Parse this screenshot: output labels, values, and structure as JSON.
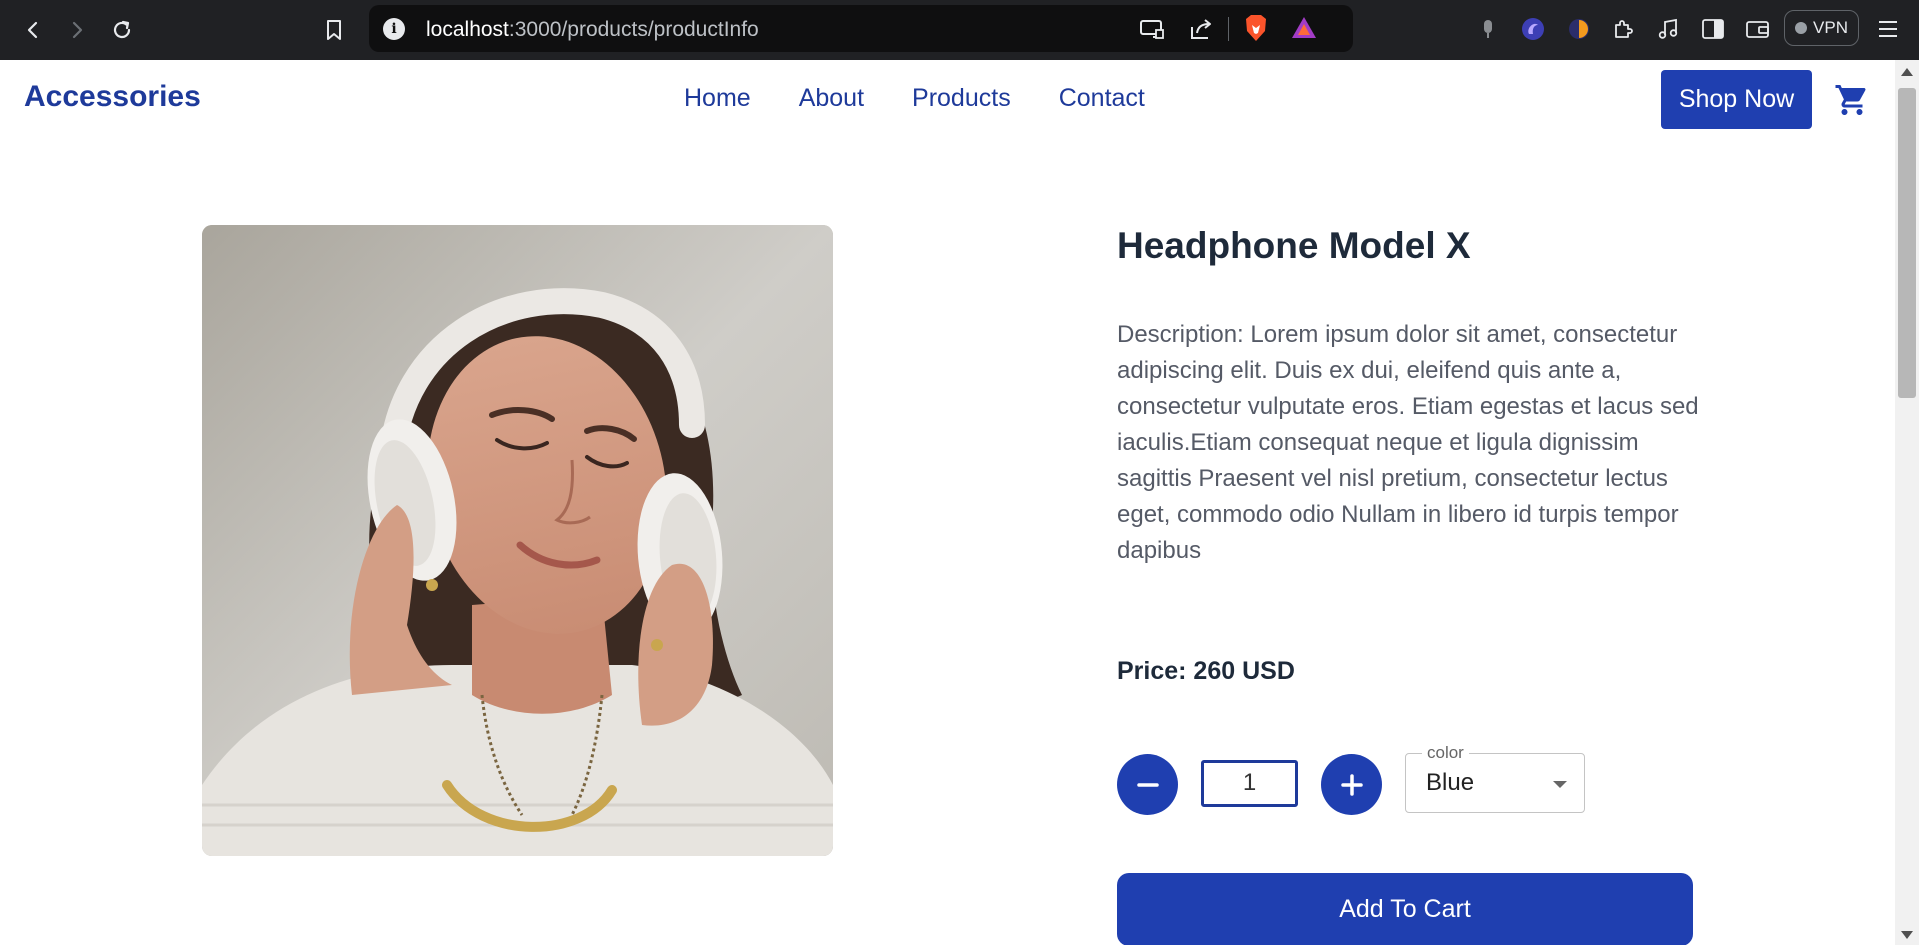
{
  "browser": {
    "url_host": "localhost",
    "url_path": ":3000/products/productInfo",
    "vpn_label": "VPN"
  },
  "header": {
    "brand": "Accessories",
    "nav": [
      "Home",
      "About",
      "Products",
      "Contact"
    ],
    "shop_now_label": "Shop Now"
  },
  "product": {
    "title": "Headphone Model X",
    "description": "Description: Lorem ipsum dolor sit amet, consectetur adipiscing elit. Duis ex dui, eleifend quis ante a, consectetur vulputate eros. Etiam egestas et lacus sed iaculis.Etiam consequat neque et ligula dignissim sagittis Praesent vel nisl pretium, consectetur lectus eget, commodo odio Nullam in libero id turpis tempor dapibus",
    "price": "Price: 260 USD",
    "quantity": "1",
    "color_label": "color",
    "color_value": "Blue",
    "add_to_cart_label": "Add To Cart"
  },
  "colors": {
    "brand_blue": "#1f3fb0",
    "text_dark": "#1e2a3a",
    "chrome_bg": "#202124"
  }
}
